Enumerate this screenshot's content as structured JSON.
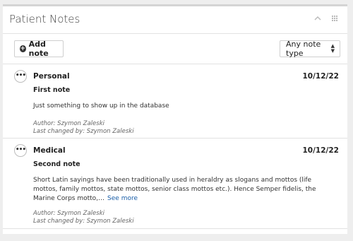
{
  "panel": {
    "title": "Patient Notes",
    "collapse_icon": "chevron-up-icon",
    "menu_icon": "grid-icon"
  },
  "toolbar": {
    "add_label": "Add note",
    "filter_value": "Any note type"
  },
  "notes": [
    {
      "type": "Personal",
      "date": "10/12/22",
      "title": "First note",
      "body": "Just something to show up in the database",
      "author": "Author: Szymon Zaleski",
      "changed_by": "Last changed by: Szymon Zaleski"
    },
    {
      "type": "Medical",
      "date": "10/12/22",
      "title": "Second note",
      "body": "Short Latin sayings have been traditionally used in heraldry as slogans and mottos (life mottos, family mottos, state mottos, senior class mottos etc.). Hence Semper fidelis, the Marine Corps motto,…",
      "see_more": "See more",
      "author": "Author: Szymon Zaleski",
      "changed_by": "Last changed by: Szymon Zaleski"
    }
  ]
}
